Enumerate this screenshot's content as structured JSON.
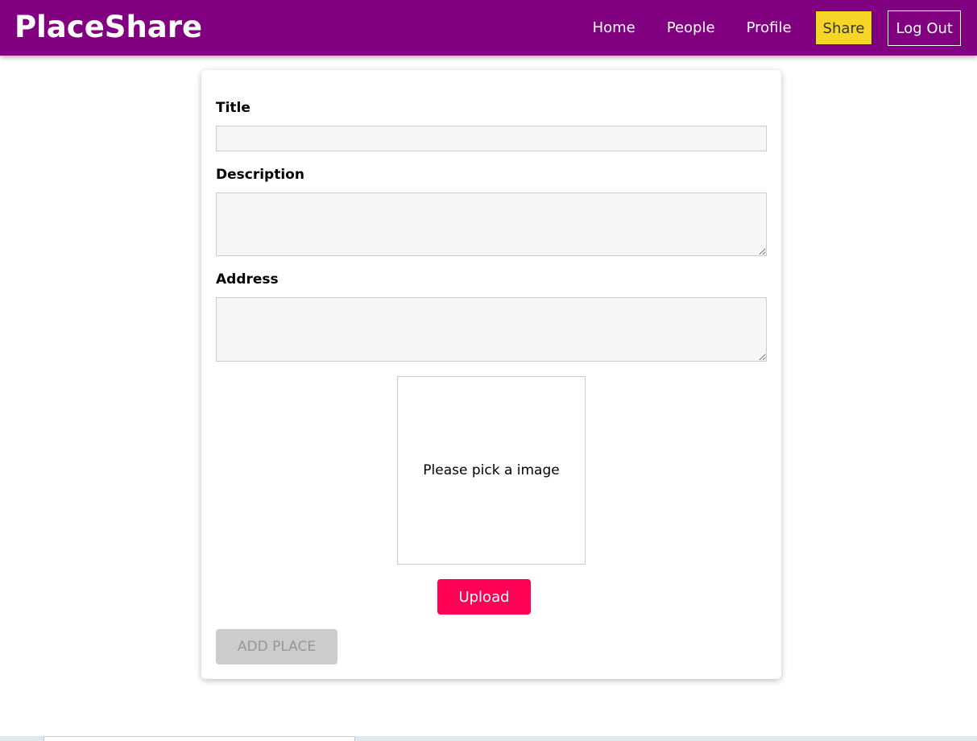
{
  "header": {
    "logo": "PlaceShare",
    "brand_color": "#800080",
    "nav": {
      "home": "Home",
      "people": "People",
      "profile": "Profile",
      "share": "Share",
      "logout": "Log Out"
    },
    "share_active_color": "#f5d525"
  },
  "form": {
    "title_label": "Title",
    "title_value": "",
    "description_label": "Description",
    "description_value": "",
    "address_label": "Address",
    "address_value": "",
    "image_placeholder": "Please pick a image",
    "upload_label": "Upload",
    "upload_color": "#ff0055",
    "submit_label": "ADD PLACE",
    "submit_disabled": true
  }
}
